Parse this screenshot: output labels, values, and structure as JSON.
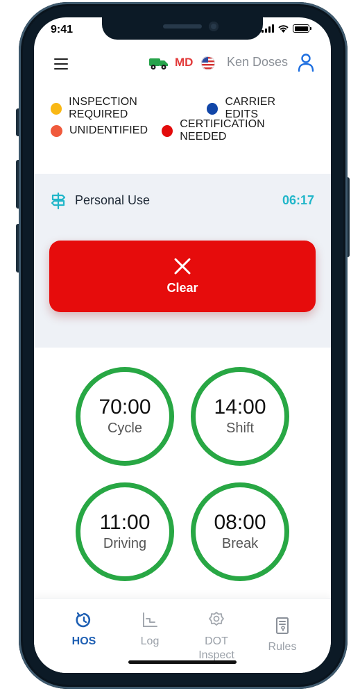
{
  "status_bar": {
    "time": "9:41"
  },
  "header": {
    "state_code": "MD",
    "driver_name": "Ken Doses",
    "colors": {
      "truck": "#27a34b",
      "state": "#27a34b"
    }
  },
  "legend": {
    "items": [
      {
        "label": "INSPECTION REQUIRED",
        "color": "#f9b815"
      },
      {
        "label": "CARRIER EDITS",
        "color": "#1146a8"
      },
      {
        "label": "UNIDENTIFIED",
        "color": "#f05a3c"
      },
      {
        "label": "CERTIFICATION NEEDED",
        "color": "#e30b0b"
      }
    ]
  },
  "duty_status": {
    "name": "Personal Use",
    "timer": "06:17",
    "action_label": "Clear",
    "action_color": "#e60c0c"
  },
  "clocks": [
    {
      "value": "70:00",
      "label": "Cycle"
    },
    {
      "value": "14:00",
      "label": "Shift"
    },
    {
      "value": "11:00",
      "label": "Driving"
    },
    {
      "value": "08:00",
      "label": "Break"
    }
  ],
  "nav": {
    "active": "HOS",
    "items": [
      {
        "label": "HOS",
        "icon": "clock-icon"
      },
      {
        "label": "Log",
        "icon": "chart-icon"
      },
      {
        "label": "DOT\nInspect",
        "icon": "badge-icon"
      },
      {
        "label": "Rules",
        "icon": "document-icon"
      }
    ]
  }
}
